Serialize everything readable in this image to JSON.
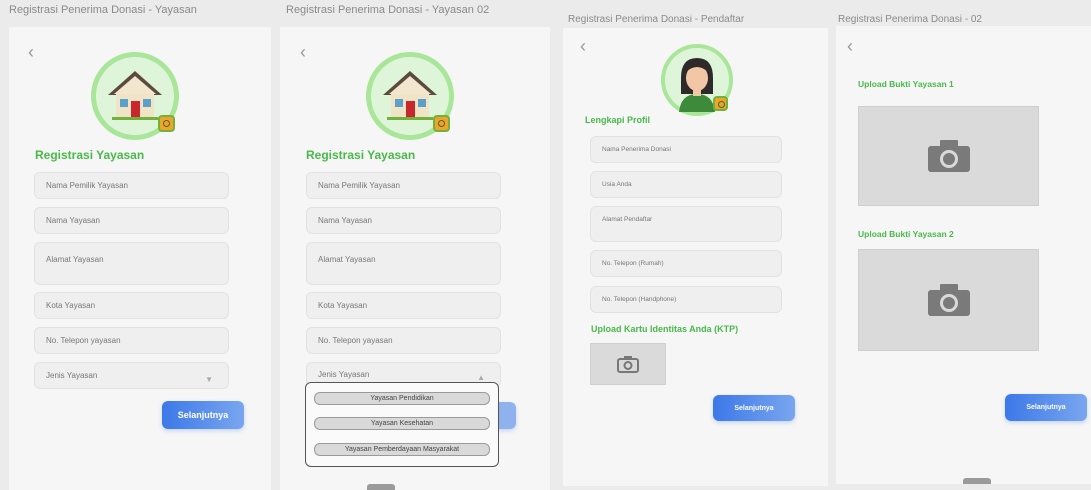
{
  "frames": {
    "f1": {
      "title": "Registrasi Penerima Donasi - Yayasan"
    },
    "f2": {
      "title": "Registrasi Penerima Donasi - Yayasan 02"
    },
    "f3": {
      "title": "Registrasi Penerima Donasi - Pendaftar"
    },
    "f4": {
      "title": "Registrasi Penerima Donasi - 02"
    }
  },
  "common": {
    "back_icon": "‹",
    "heading_yayasan": "Registrasi Yayasan",
    "fields": {
      "nama_pemilik": "Nama  Pemilik Yayasan",
      "nama_yayasan": "Nama Yayasan",
      "alamat": "Alamat Yayasan",
      "kota": "Kota Yayasan",
      "telepon": "No. Telepon yayasan",
      "jenis": "Jenis Yayasan"
    },
    "next_button": "Selanjutnya",
    "caret_down": "▼",
    "caret_up": "▲"
  },
  "dropdown_options": [
    "Yayasan Pendidikan",
    "Yayasan Kesehatan",
    "Yayasan Pemberdayaan Masyarakat"
  ],
  "pendaftar": {
    "heading": "Lengkapi Profil",
    "fields": {
      "nama": "Nama Penerima Donasi",
      "usia": "Usia Anda",
      "alamat": "Alamat Pendaftar",
      "tel_rumah": "No. Telepon  (Rumah)",
      "tel_hp": "No. Telepon  (Handphone)"
    },
    "ktp_heading": "Upload Kartu Identitas Anda (KTP)"
  },
  "bukti": {
    "upload_1": "Upload Bukti Yayasan 1",
    "upload_2": "Upload Bukti Yayasan 2"
  },
  "icons": {
    "avatar_house": "house-icon",
    "avatar_person": "person-avatar-icon",
    "camera": "camera-icon"
  },
  "colors": {
    "accent_green": "#49b94a",
    "button_blue": "#3c78e8",
    "avatar_ring": "#a9e69a"
  }
}
